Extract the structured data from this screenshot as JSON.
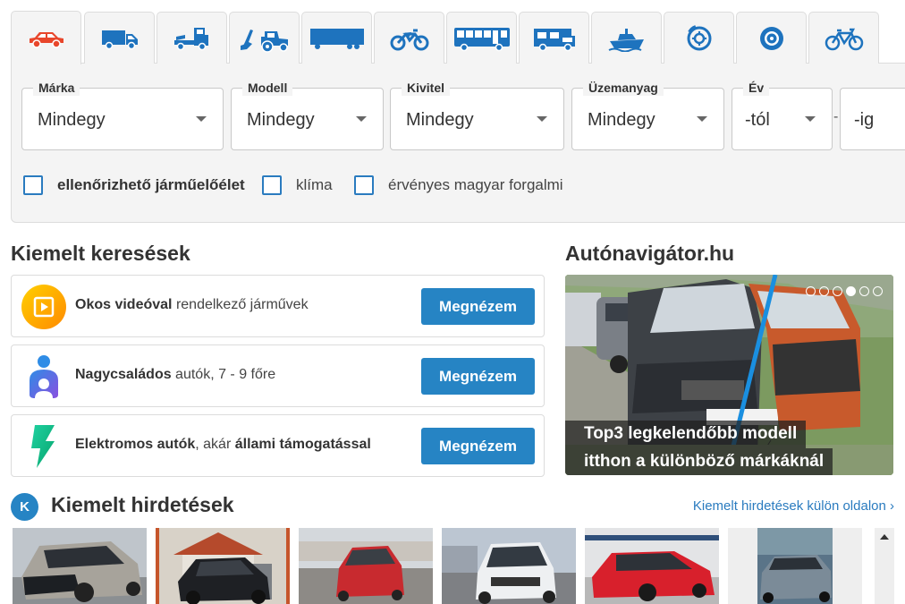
{
  "vehicle_tabs": [
    {
      "icon": "car-icon",
      "active": true
    },
    {
      "icon": "van-icon"
    },
    {
      "icon": "truck-icon"
    },
    {
      "icon": "tractor-excavator-icon"
    },
    {
      "icon": "trailer-icon"
    },
    {
      "icon": "motorcycle-icon"
    },
    {
      "icon": "bus-icon"
    },
    {
      "icon": "camper-icon"
    },
    {
      "icon": "boat-icon"
    },
    {
      "icon": "brake-disc-icon"
    },
    {
      "icon": "tire-icon"
    },
    {
      "icon": "bicycle-icon"
    }
  ],
  "filters": {
    "brand": {
      "label": "Márka",
      "value": "Mindegy"
    },
    "model": {
      "label": "Modell",
      "value": "Mindegy"
    },
    "body": {
      "label": "Kivitel",
      "value": "Mindegy"
    },
    "fuel": {
      "label": "Üzemanyag",
      "value": "Mindegy"
    },
    "year": {
      "label": "Év",
      "from": "-tól",
      "to": "-ig"
    }
  },
  "checkboxes": {
    "history": "ellenőrizhető járműelőélet",
    "ac": "klíma",
    "registration": "érvényes magyar forgalmi"
  },
  "featured_searches": {
    "title": "Kiemelt keresések",
    "items": [
      {
        "bold": "Okos videóval",
        "rest": " rendelkező járművek",
        "button": "Megnézem"
      },
      {
        "bold": "Nagycsaládos",
        "rest": " autók, 7 - 9 főre",
        "button": "Megnézem"
      },
      {
        "bold": "Elektromos autók",
        "rest": ", akár ",
        "bold2": "állami támogatással",
        "button": "Megnézem"
      }
    ]
  },
  "promo": {
    "title": "Autónavigátor.hu",
    "caption_line1": "Top3 legkelendőbb modell",
    "caption_line2": "itthon a különböző márkáknál",
    "active_dot": 4,
    "dot_count": 6
  },
  "featured_ads": {
    "badge": "K",
    "title": "Kiemelt hirdetések",
    "link": "Kiemelt hirdetések külön oldalon ›"
  },
  "colors": {
    "accent": "#2684c4",
    "tab_icon": "#1e73be",
    "car_icon_active": "#e8462b"
  }
}
